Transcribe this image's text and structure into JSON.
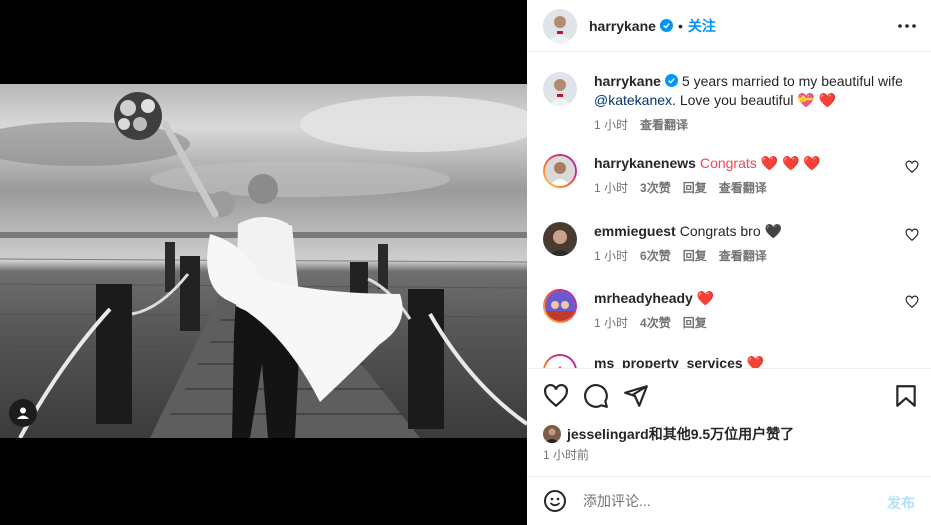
{
  "post": {
    "author": "harrykane",
    "follow_label": "关注",
    "dot": "•",
    "caption_text": "5 years married to my beautiful wife",
    "caption_mention": "@katekanex",
    "caption_tail": "Love you beautiful 💝 ❤️",
    "caption_time": "1 小时",
    "see_translation": "查看翻译"
  },
  "comments": [
    {
      "user": "harrykanenews",
      "text": "Congrats ❤️ ❤️ ❤️",
      "time": "1 小时",
      "likes": "3次赞",
      "reply": "回复",
      "translate": "查看翻译"
    },
    {
      "user": "emmieguest",
      "text": "Congrats bro 🖤",
      "time": "1 小时",
      "likes": "6次赞",
      "reply": "回复",
      "translate": "查看翻译"
    },
    {
      "user": "mrheadyheady",
      "text": "❤️",
      "time": "1 小时",
      "likes": "4次赞",
      "reply": "回复"
    },
    {
      "user": "ms_property_services",
      "text": "❤️"
    }
  ],
  "likes_summary": "jesselingard和其他9.5万位用户赞了",
  "post_time": "1 小时前",
  "composer": {
    "placeholder": "添加评论...",
    "post_label": "发布"
  },
  "icons": [
    "verified-icon",
    "more-icon",
    "heart-icon",
    "comment-icon",
    "share-icon",
    "bookmark-icon",
    "emoji-icon",
    "user-tag-icon"
  ],
  "colors": {
    "accent": "#0095f6",
    "heart": "#ed4956",
    "muted": "#737373",
    "post_disabled": "#b2dffc"
  }
}
